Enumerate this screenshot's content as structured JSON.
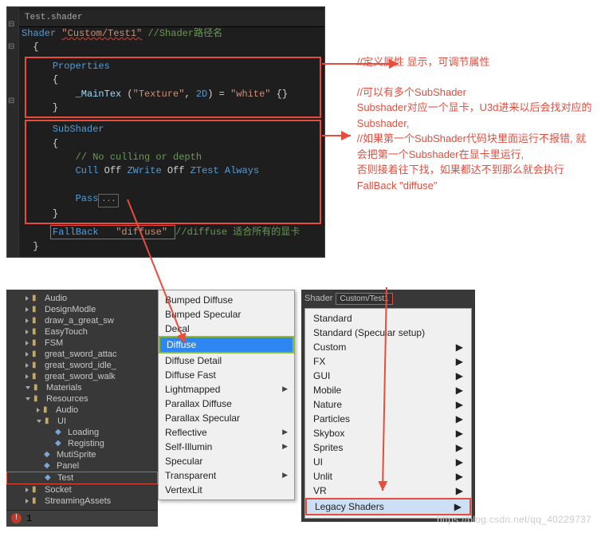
{
  "editor": {
    "tab": "Test.shader",
    "l1_kw": "Shader",
    "l1_str": "\"Custom/Test1\"",
    "l1_cm": " //Shader路径名",
    "brace_open": "{",
    "props_kw": "Properties",
    "props_brace_o": "{",
    "maintex": "_MainTex (\"Texture\", 2D) = \"white\" {}",
    "props_brace_c": "}",
    "sub_kw": "SubShader",
    "sub_brace_o": "{",
    "sub_cm": "// No culling or depth",
    "cull_kw_1": "Cull",
    "cull_off_1": " Off ",
    "cull_kw_2": "ZWrite",
    "cull_off_2": " Off ",
    "cull_kw_3": "ZTest",
    "cull_val_3": " Always",
    "pass": "Pass",
    "pass_dots": "...",
    "sub_brace_c": "}",
    "fb_kw": "FallBack",
    "fb_str": "\"diffuse\"",
    "fb_cm": "//diffuse 适合所有的显卡",
    "brace_close": "}"
  },
  "annot": {
    "a1": "//定义属性   显示，可调节属性",
    "a2": "  //可以有多个SubShader",
    "a3": "Subshader对应一个显卡，U3d进来以后会找对应的Subshader,",
    "a4": "//如果第一个SubShader代码块里面运行不报错,    就会把第一个Subshader在显卡里运行,",
    "a5": "       否则接着往下找，如果都达不到那么就会执行FallBack  \"diffuse\""
  },
  "tree": [
    {
      "name": "Audio",
      "icon": "folder",
      "indent": 1,
      "tri": ">"
    },
    {
      "name": "DesignModle",
      "icon": "folder",
      "indent": 1,
      "tri": ">"
    },
    {
      "name": "draw_a_great_sw",
      "icon": "folder",
      "indent": 1,
      "tri": ">"
    },
    {
      "name": "EasyTouch",
      "icon": "folder",
      "indent": 1,
      "tri": ">"
    },
    {
      "name": "FSM",
      "icon": "folder",
      "indent": 1,
      "tri": ">"
    },
    {
      "name": "great_sword_attac",
      "icon": "folder",
      "indent": 1,
      "tri": ">"
    },
    {
      "name": "great_sword_idle_",
      "icon": "folder",
      "indent": 1,
      "tri": ">"
    },
    {
      "name": "great_sword_walk",
      "icon": "folder",
      "indent": 1,
      "tri": ">"
    },
    {
      "name": "Materials",
      "icon": "folder",
      "indent": 1,
      "tri": "v"
    },
    {
      "name": "Resources",
      "icon": "folder",
      "indent": 1,
      "tri": "v"
    },
    {
      "name": "Audio",
      "icon": "folder",
      "indent": 2,
      "tri": ">"
    },
    {
      "name": "UI",
      "icon": "folder",
      "indent": 2,
      "tri": "v"
    },
    {
      "name": "Loading",
      "icon": "file",
      "indent": 3,
      "tri": ""
    },
    {
      "name": "Registing",
      "icon": "file",
      "indent": 3,
      "tri": ""
    },
    {
      "name": "MutiSprite",
      "icon": "file",
      "indent": 2,
      "tri": ""
    },
    {
      "name": "Panel",
      "icon": "file",
      "indent": 2,
      "tri": ""
    },
    {
      "name": "Test",
      "icon": "file",
      "indent": 2,
      "tri": "",
      "red": true
    },
    {
      "name": "Socket",
      "icon": "folder",
      "indent": 1,
      "tri": ">"
    },
    {
      "name": "StreamingAssets",
      "icon": "folder",
      "indent": 1,
      "tri": ">"
    }
  ],
  "status": {
    "err_count": "1"
  },
  "menu1": [
    {
      "label": "Bumped Diffuse",
      "sub": false
    },
    {
      "label": "Bumped Specular",
      "sub": false
    },
    {
      "label": "Decal",
      "sub": false
    },
    {
      "label": "Diffuse",
      "sub": false,
      "hover": true
    },
    {
      "label": "Diffuse Detail",
      "sub": false
    },
    {
      "label": "Diffuse Fast",
      "sub": false
    },
    {
      "label": "Lightmapped",
      "sub": true
    },
    {
      "label": "Parallax Diffuse",
      "sub": false
    },
    {
      "label": "Parallax Specular",
      "sub": false
    },
    {
      "label": "Reflective",
      "sub": true
    },
    {
      "label": "Self-Illumin",
      "sub": true
    },
    {
      "label": "Specular",
      "sub": false
    },
    {
      "label": "Transparent",
      "sub": true
    },
    {
      "label": "VertexLit",
      "sub": false
    }
  ],
  "inspector": {
    "shader_lbl": "Shader",
    "shader_val": "Custom/Test1"
  },
  "menu2": [
    {
      "label": "Standard",
      "sub": false
    },
    {
      "label": "Standard (Specular setup)",
      "sub": false
    },
    {
      "label": "Custom",
      "sub": true
    },
    {
      "label": "FX",
      "sub": true
    },
    {
      "label": "GUI",
      "sub": true
    },
    {
      "label": "Mobile",
      "sub": true
    },
    {
      "label": "Nature",
      "sub": true
    },
    {
      "label": "Particles",
      "sub": true
    },
    {
      "label": "Skybox",
      "sub": true
    },
    {
      "label": "Sprites",
      "sub": true
    },
    {
      "label": "UI",
      "sub": true
    },
    {
      "label": "Unlit",
      "sub": true
    },
    {
      "label": "VR",
      "sub": true
    },
    {
      "label": "Legacy Shaders",
      "sub": true,
      "red": true
    }
  ],
  "watermark": "https://blog.csdn.net/qq_40229737"
}
